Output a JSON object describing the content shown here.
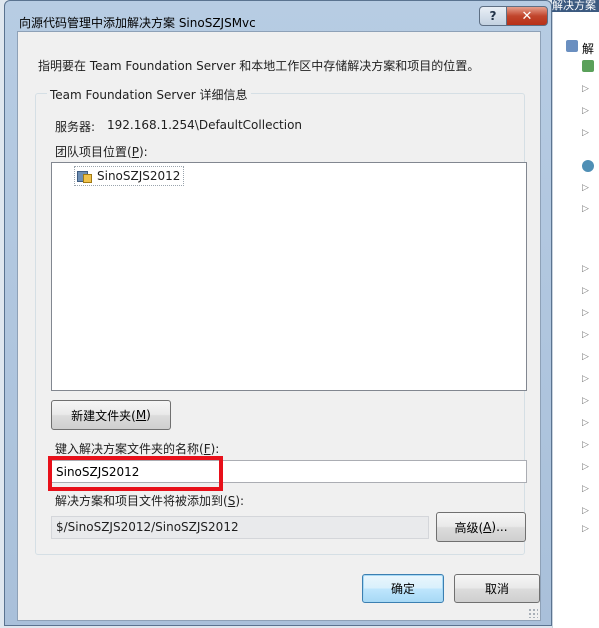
{
  "background": {
    "header_text": "解决方案",
    "title_fragment": "解",
    "arrow_glyph": "▷"
  },
  "window": {
    "title": "向源代码管理中添加解决方案 SinoSZJSMvc",
    "help_glyph": "?",
    "close_glyph": "✕"
  },
  "dialog": {
    "instruction": "指明要在 Team Foundation Server 和本地工作区中存储解决方案和项目的位置。",
    "group_title": "Team Foundation Server 详细信息",
    "server_label": "服务器:",
    "server_value": "192.168.1.254\\DefaultCollection",
    "project_location_label_prefix": "团队项目位置(",
    "project_location_label_key": "P",
    "project_location_label_suffix": "):",
    "tree_items": [
      {
        "label": "SinoSZJS2012"
      }
    ],
    "new_folder_button_prefix": "新建文件夹(",
    "new_folder_button_key": "M",
    "new_folder_button_suffix": ")",
    "name_label_prefix": "键入解决方案文件夹的名称(",
    "name_label_key": "F",
    "name_label_suffix": "):",
    "name_value": "SinoSZJS2012",
    "added_label_prefix": "解决方案和项目文件将被添加到(",
    "added_label_key": "S",
    "added_label_suffix": "):",
    "path_value": "$/SinoSZJS2012/SinoSZJS2012",
    "advanced_button_prefix": "高级(",
    "advanced_button_key": "A",
    "advanced_button_suffix": ")...",
    "ok_button": "确定",
    "cancel_button": "取消"
  },
  "colors": {
    "highlight_box": "#e8101a",
    "title_bar": "#b7cce3",
    "close_button": "#c1452c"
  }
}
